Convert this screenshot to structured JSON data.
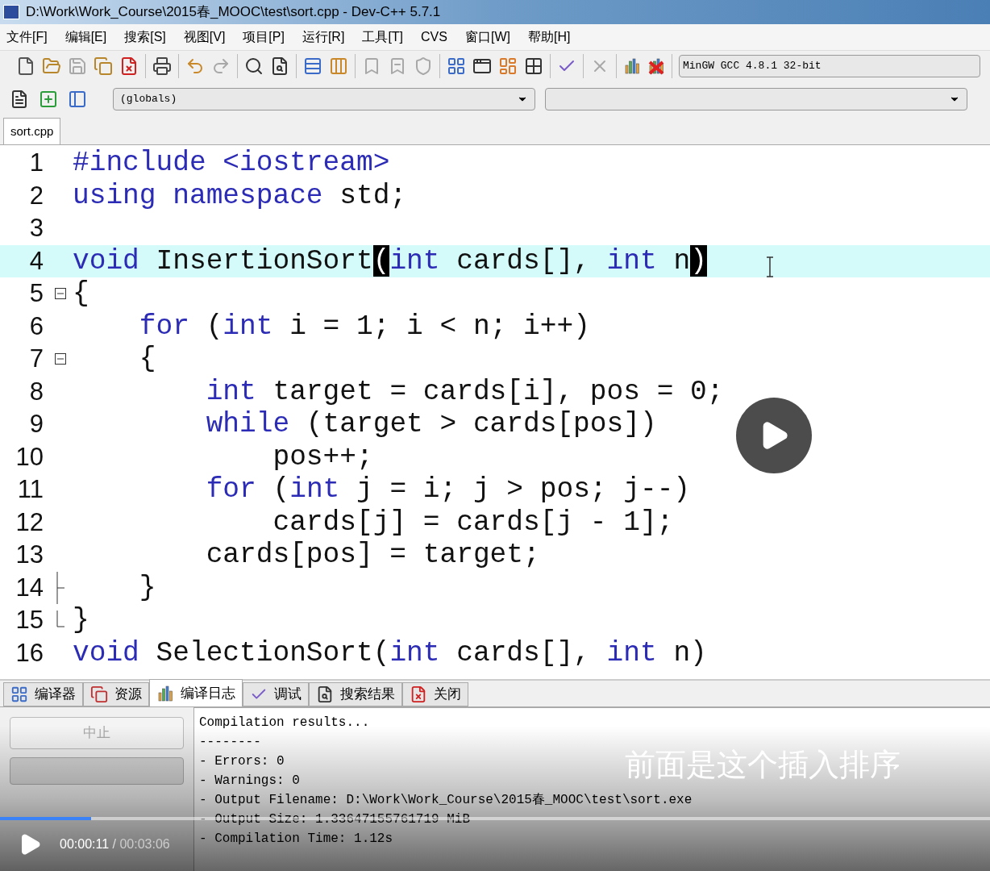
{
  "window": {
    "title": "D:\\Work\\Work_Course\\2015春_MOOC\\test\\sort.cpp - Dev-C++ 5.7.1"
  },
  "menu": [
    "文件[F]",
    "编辑[E]",
    "搜索[S]",
    "视图[V]",
    "项目[P]",
    "运行[R]",
    "工具[T]",
    "CVS",
    "窗口[W]",
    "帮助[H]"
  ],
  "toolbar": {
    "groups": [
      [
        {
          "disabled": false
        },
        {
          "disabled": false
        },
        {
          "disabled": true
        },
        {
          "disabled": false
        },
        {
          "disabled": false
        }
      ],
      [
        {
          "disabled": false
        }
      ],
      [
        {
          "disabled": false
        },
        {
          "disabled": true
        }
      ],
      [
        {
          "disabled": false
        },
        {
          "disabled": false
        }
      ],
      [
        {
          "disabled": false
        },
        {
          "disabled": false
        }
      ],
      [
        {
          "disabled": true
        },
        {
          "disabled": true
        },
        {
          "disabled": true
        }
      ],
      [
        {
          "disabled": false
        },
        {
          "disabled": false
        },
        {
          "disabled": false
        },
        {
          "disabled": false
        }
      ],
      [
        {
          "disabled": false
        }
      ],
      [
        {
          "disabled": true
        }
      ],
      [
        {
          "disabled": false
        },
        {
          "disabled": false
        }
      ]
    ]
  },
  "compiler_select": {
    "value": "MinGW GCC 4.8.1 32-bit"
  },
  "class_select": {
    "value": "(globals)"
  },
  "editor_tabs": [
    {
      "label": "sort.cpp",
      "selected": true
    }
  ],
  "code_lines": [
    {
      "number": "1",
      "highlighted": false,
      "tokens": [
        {
          "text": "#include <iostream>",
          "kind": "preprocessor"
        }
      ]
    },
    {
      "number": "2",
      "highlighted": false,
      "tokens": [
        {
          "text": "using",
          "kind": "keyword"
        },
        {
          "text": " namespace",
          "kind": "keyword"
        },
        {
          "text": " std;",
          "kind": "plain"
        }
      ]
    },
    {
      "number": "3",
      "highlighted": false
    },
    {
      "number": "4",
      "highlighted": true,
      "tokens": [
        {
          "text": "void",
          "kind": "keyword"
        },
        {
          "text": " InsertionSort",
          "kind": "plain"
        },
        {
          "text": "(",
          "kind": "match"
        },
        {
          "text": "int",
          "kind": "keyword"
        },
        {
          "text": " cards[], ",
          "kind": "plain"
        },
        {
          "text": "int",
          "kind": "keyword"
        },
        {
          "text": " n",
          "kind": "plain"
        },
        {
          "text": ")",
          "kind": "match"
        }
      ]
    },
    {
      "number": "5",
      "highlighted": false,
      "fold": {
        "kind": "open"
      },
      "tokens": [
        {
          "text": "{",
          "kind": "plain"
        }
      ]
    },
    {
      "number": "6",
      "highlighted": false,
      "tokens": [
        {
          "text": "    for",
          "kind": "keyword"
        },
        {
          "text": " (",
          "kind": "plain"
        },
        {
          "text": "int",
          "kind": "keyword"
        },
        {
          "text": " i = 1; i < n; i++)",
          "kind": "plain"
        }
      ]
    },
    {
      "number": "7",
      "highlighted": false,
      "fold": {
        "kind": "open"
      },
      "tokens": [
        {
          "text": "    {",
          "kind": "plain"
        }
      ]
    },
    {
      "number": "8",
      "highlighted": false,
      "tokens": [
        {
          "text": "        int",
          "kind": "keyword"
        },
        {
          "text": " target = cards[i], pos = 0;",
          "kind": "plain"
        }
      ]
    },
    {
      "number": "9",
      "highlighted": false,
      "tokens": [
        {
          "text": "        while",
          "kind": "keyword"
        },
        {
          "text": " (target > cards[pos])",
          "kind": "plain"
        }
      ]
    },
    {
      "number": "10",
      "highlighted": false,
      "tokens": [
        {
          "text": "            pos++;",
          "kind": "plain"
        }
      ]
    },
    {
      "number": "11",
      "highlighted": false,
      "tokens": [
        {
          "text": "        for",
          "kind": "keyword"
        },
        {
          "text": " (",
          "kind": "plain"
        },
        {
          "text": "int",
          "kind": "keyword"
        },
        {
          "text": " j = i; j > pos; j--)",
          "kind": "plain"
        }
      ]
    },
    {
      "number": "12",
      "highlighted": false,
      "tokens": [
        {
          "text": "            cards[j] = cards[j - 1];",
          "kind": "plain"
        }
      ]
    },
    {
      "number": "13",
      "highlighted": false,
      "tokens": [
        {
          "text": "        cards[pos] = target;",
          "kind": "plain"
        }
      ]
    },
    {
      "number": "14",
      "highlighted": false,
      "fold": {
        "kind": "inner-end"
      },
      "tokens": [
        {
          "text": "    }",
          "kind": "plain"
        }
      ]
    },
    {
      "number": "15",
      "highlighted": false,
      "fold": {
        "kind": "end"
      },
      "tokens": [
        {
          "text": "}",
          "kind": "plain"
        }
      ]
    },
    {
      "number": "16",
      "highlighted": false,
      "tokens": [
        {
          "text": "void",
          "kind": "keyword"
        },
        {
          "text": " SelectionSort(",
          "kind": "plain"
        },
        {
          "text": "int",
          "kind": "keyword"
        },
        {
          "text": " cards[], ",
          "kind": "plain"
        },
        {
          "text": "int",
          "kind": "keyword"
        },
        {
          "text": " n)",
          "kind": "plain"
        }
      ]
    }
  ],
  "bottom_tabs": [
    {
      "label": "编译器",
      "selected": false
    },
    {
      "label": "资源",
      "selected": false
    },
    {
      "label": "编译日志",
      "selected": true
    },
    {
      "label": "调试",
      "selected": false
    },
    {
      "label": "搜索结果",
      "selected": false
    },
    {
      "label": "关闭",
      "selected": false
    }
  ],
  "abort_button": {
    "label": "中止",
    "disabled": true
  },
  "compile_progress": {
    "level": 0
  },
  "log_lines": [
    "Compilation results...",
    "--------",
    "- Errors: 0",
    "- Warnings: 0",
    "- Output Filename: D:\\Work\\Work_Course\\2015春_MOOC\\test\\sort.exe",
    "- Output Size: 1.33647155761719 MiB",
    "- Compilation Time: 1.12s"
  ],
  "video": {
    "paused": true,
    "subtitle": "前面是这个插入排序",
    "progress": {
      "level": 0.092
    },
    "current_time": "00:00:11",
    "time_separator": "/",
    "duration": "00:03:06"
  }
}
